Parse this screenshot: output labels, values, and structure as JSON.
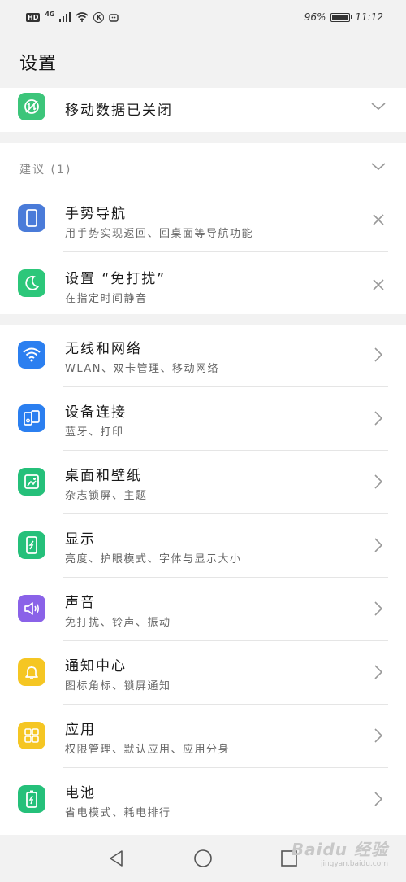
{
  "status_bar": {
    "hd": "HD",
    "network": "4G",
    "k_badge": "K",
    "battery_percent": "96%",
    "battery_level": 0.96,
    "time": "11:12"
  },
  "page_title": "设置",
  "mobile_data": {
    "label": "移动数据已关闭",
    "icon": "mobile-data-off-icon",
    "color": "#3cc57a"
  },
  "suggestions": {
    "header": "建议 (1)",
    "items": [
      {
        "title": "手势导航",
        "subtitle": "用手势实现返回、回桌面等导航功能",
        "icon": "gesture-phone-icon",
        "color": "#4a7bd9"
      },
      {
        "title": "设置 “免打扰”",
        "subtitle": "在指定时间静音",
        "icon": "moon-icon",
        "color": "#2cc77a"
      }
    ]
  },
  "settings": [
    {
      "title": "无线和网络",
      "subtitle": "WLAN、双卡管理、移动网络",
      "icon": "wifi-icon",
      "color": "#2b7ff0"
    },
    {
      "title": "设备连接",
      "subtitle": "蓝牙、打印",
      "icon": "device-connect-icon",
      "color": "#2b7ff0"
    },
    {
      "title": "桌面和壁纸",
      "subtitle": "杂志锁屏、主题",
      "icon": "wallpaper-icon",
      "color": "#25c07a"
    },
    {
      "title": "显示",
      "subtitle": "亮度、护眼模式、字体与显示大小",
      "icon": "display-icon",
      "color": "#25c07a"
    },
    {
      "title": "声音",
      "subtitle": "免打扰、铃声、振动",
      "icon": "speaker-icon",
      "color": "#8a62e8"
    },
    {
      "title": "通知中心",
      "subtitle": "图标角标、锁屏通知",
      "icon": "bell-icon",
      "color": "#f5c623"
    },
    {
      "title": "应用",
      "subtitle": "权限管理、默认应用、应用分身",
      "icon": "apps-grid-icon",
      "color": "#f5c623"
    },
    {
      "title": "电池",
      "subtitle": "省电模式、耗电排行",
      "icon": "battery-icon",
      "color": "#25c07a"
    }
  ],
  "watermark": {
    "main": "Baidu 经验",
    "sub": "jingyan.baidu.com"
  }
}
